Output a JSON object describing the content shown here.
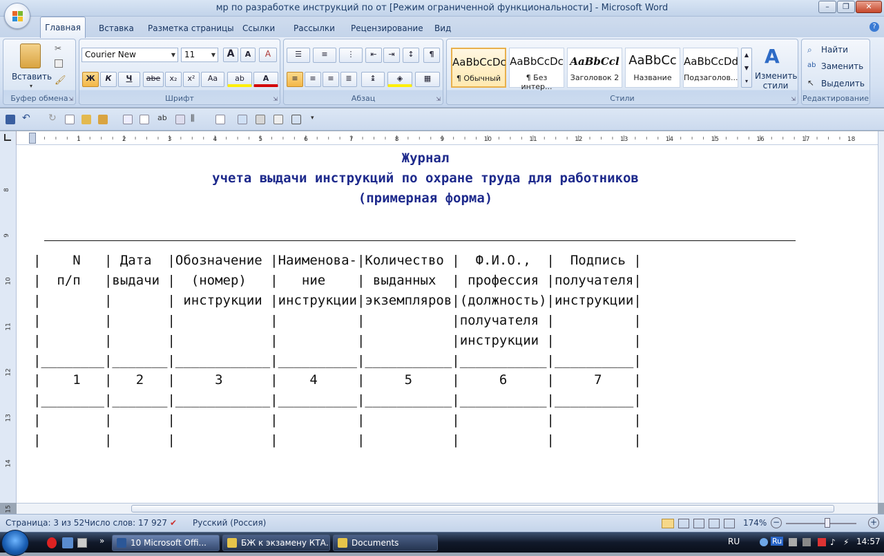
{
  "window": {
    "title": "мр по разработке инструкций по от [Режим ограниченной функциональности] - Microsoft Word",
    "minimize": "–",
    "maximize": "❐",
    "close": "✕"
  },
  "tabs": [
    {
      "label": "Главная"
    },
    {
      "label": "Вставка"
    },
    {
      "label": "Разметка страницы"
    },
    {
      "label": "Ссылки"
    },
    {
      "label": "Рассылки"
    },
    {
      "label": "Рецензирование"
    },
    {
      "label": "Вид"
    }
  ],
  "ribbon": {
    "clipboard": {
      "paste_label": "Вставить",
      "group": "Буфер обмена"
    },
    "font": {
      "name": "Courier New",
      "size": "11",
      "bold": "Ж",
      "italic": "К",
      "underline": "Ч",
      "strike": "abe",
      "sub": "x₂",
      "sup": "x²",
      "case": "Aa",
      "grow": "A",
      "shrink": "A",
      "clear": "A",
      "highlight": "ab",
      "color": "A",
      "group": "Шрифт"
    },
    "paragraph": {
      "group": "Абзац",
      "show_marks": "¶"
    },
    "styles": {
      "items": [
        {
          "sample": "AaBbCcDc",
          "name": "¶ Обычный"
        },
        {
          "sample": "AaBbCcDc",
          "name": "¶ Без интер..."
        },
        {
          "sample": "AaBbCcl",
          "name": "Заголовок 2"
        },
        {
          "sample": "AaBbCc",
          "name": "Название"
        },
        {
          "sample": "AaBbCcDd",
          "name": "Подзаголов..."
        }
      ],
      "change_label": "Изменить стили",
      "group": "Стили"
    },
    "editing": {
      "find": "Найти",
      "replace": "Заменить",
      "select": "Выделить",
      "group": "Редактирование"
    }
  },
  "document": {
    "heading1": "Журнал",
    "heading2": "учета выдачи инструкций по охране труда для работников",
    "heading3": "(примерная форма)",
    "table_lines": [
      "|    N   | Дата  |Обозначение |Наименова-|Количество |  Ф.И.О.,  |  Подпись |",
      "|  п/п   |выдачи |  (номер)   |   ние    | выданных  | профессия |получателя|",
      "|        |       | инструкции |инструкции|экземпляров|(должность)|инструкции|",
      "|        |       |            |          |           |получателя |          |",
      "|        |       |            |          |           |инструкции |          |",
      "|________|_______|____________|__________|___________|___________|__________|",
      "|    1   |   2   |     3      |    4     |     5     |     6     |     7    |",
      "|________|_______|____________|__________|___________|___________|__________|",
      "|        |       |            |          |           |           |          |",
      "|        |       |            |          |           |           |          |"
    ]
  },
  "statusbar": {
    "page": "Страница: 3 из 52",
    "words": "Число слов: 17 927",
    "language": "Русский (Россия)",
    "zoom": "174%"
  },
  "taskbar": {
    "items": [
      {
        "label": "10 Microsoft Offi..."
      },
      {
        "label": "БЖ к экзамену КТА..."
      },
      {
        "label": "Documents"
      }
    ],
    "lang": "RU",
    "ime": "Ru",
    "clock": "14:57"
  },
  "ruler": {
    "marks": [
      "1",
      "2",
      "3",
      "4",
      "5",
      "6",
      "7",
      "8",
      "9",
      "10",
      "11",
      "12",
      "13",
      "14",
      "15",
      "16",
      "17",
      "18"
    ],
    "vmarks": [
      "8",
      "9",
      "10",
      "11",
      "12",
      "13",
      "14",
      "15"
    ]
  },
  "colors": {
    "heading": "#1e2a8c",
    "ribbon": "#d3e0f2",
    "taskbar": "#11192a"
  }
}
